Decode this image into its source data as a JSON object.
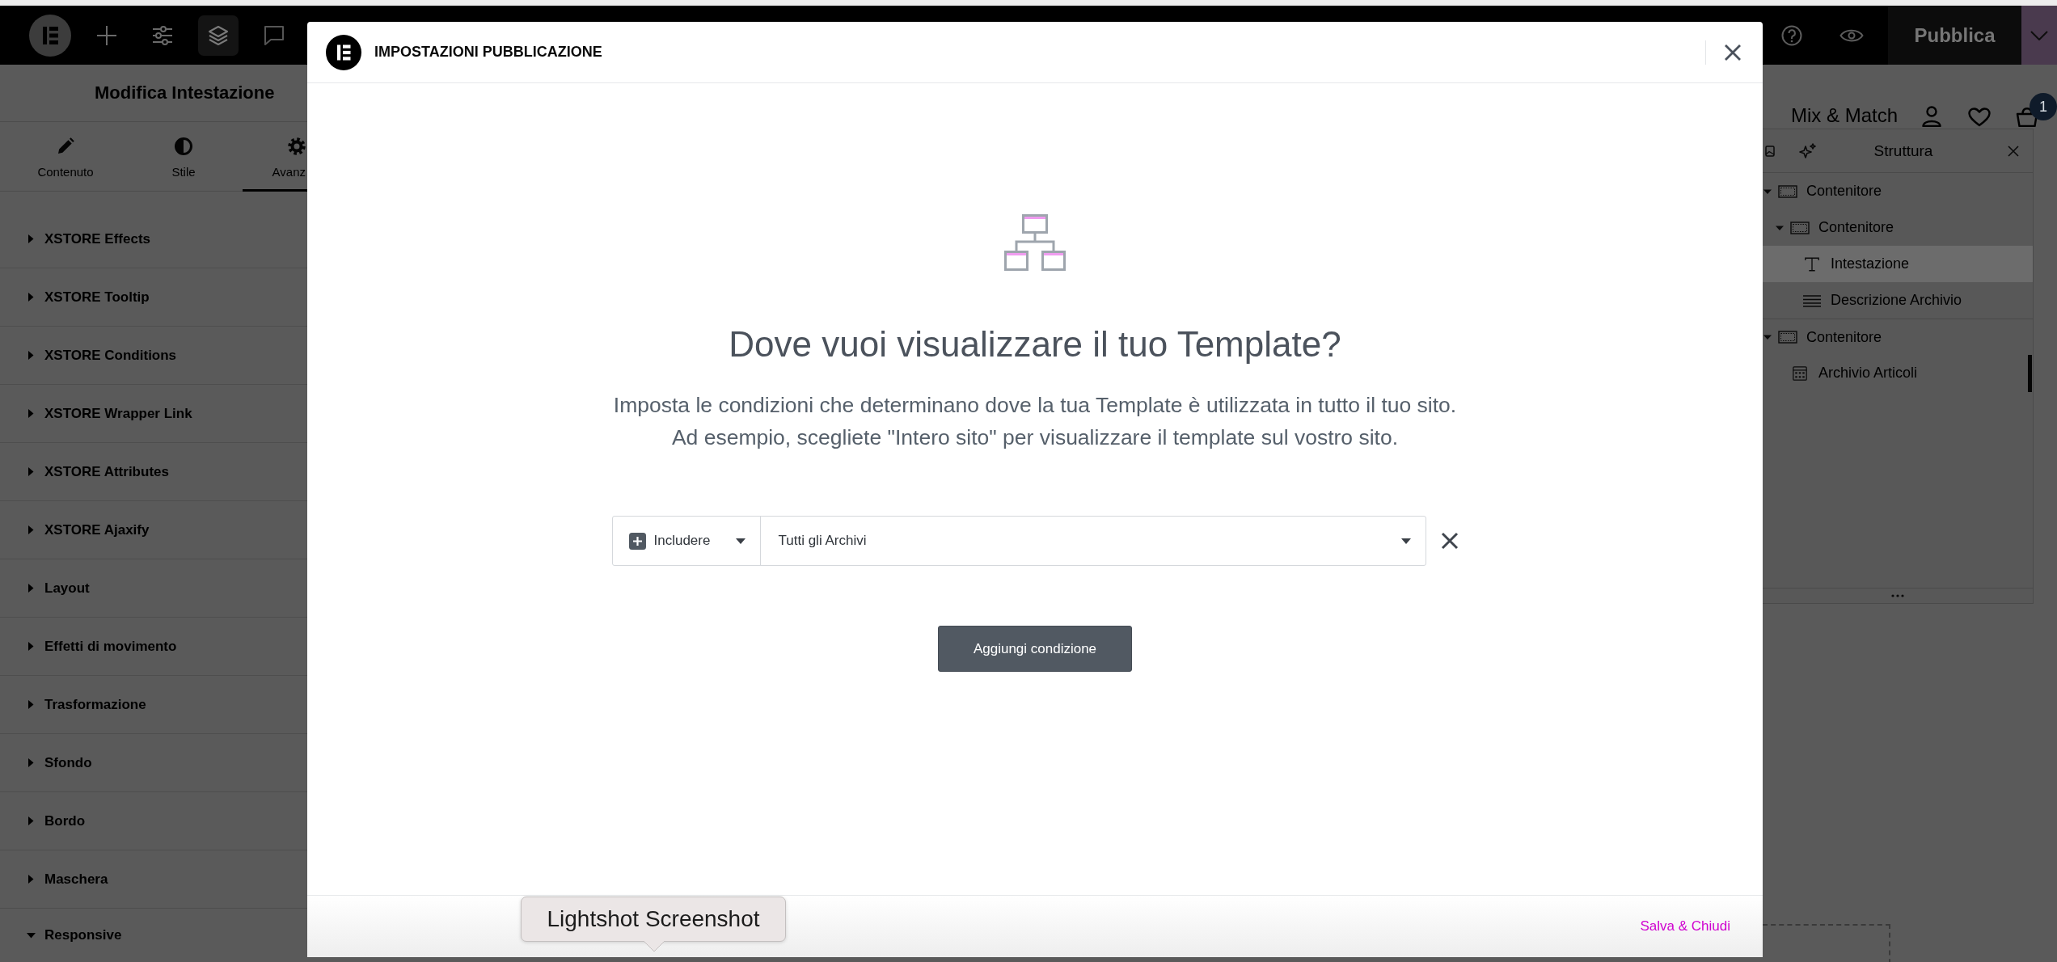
{
  "toolbar": {
    "publish_button": "Pubblica"
  },
  "editor_panel": {
    "title": "Modifica Intestazione",
    "tabs": [
      {
        "label": "Contenuto",
        "kind": "pencil",
        "selected": false
      },
      {
        "label": "Stile",
        "kind": "contrast",
        "selected": false
      },
      {
        "label": "Avanz",
        "kind": "gear",
        "selected": true
      }
    ],
    "sections": [
      {
        "label": "XSTORE Effects",
        "expanded": false
      },
      {
        "label": "XSTORE Tooltip",
        "expanded": false
      },
      {
        "label": "XSTORE Conditions",
        "expanded": false
      },
      {
        "label": "XSTORE Wrapper Link",
        "expanded": false
      },
      {
        "label": "XSTORE Attributes",
        "expanded": false
      },
      {
        "label": "XSTORE Ajaxify",
        "expanded": false
      },
      {
        "label": "Layout",
        "expanded": false
      },
      {
        "label": "Effetti di movimento",
        "expanded": false
      },
      {
        "label": "Trasformazione",
        "expanded": false
      },
      {
        "label": "Sfondo",
        "expanded": false
      },
      {
        "label": "Bordo",
        "expanded": false
      },
      {
        "label": "Maschera",
        "expanded": false
      },
      {
        "label": "Responsive",
        "expanded": true
      }
    ]
  },
  "site_header": {
    "logo": "Mix & Match",
    "cart_count": "1"
  },
  "structure_panel": {
    "title": "Struttura",
    "items": [
      {
        "label": "Contenitore",
        "kind": "container",
        "expanded": true,
        "selected": false,
        "children": [
          {
            "label": "Contenitore",
            "kind": "container",
            "expanded": true,
            "selected": false,
            "children": [
              {
                "label": "Intestazione",
                "kind": "heading",
                "selected": true
              },
              {
                "label": "Descrizione Archivio",
                "kind": "text",
                "selected": false
              }
            ]
          }
        ]
      },
      {
        "label": "Contenitore",
        "kind": "container",
        "expanded": true,
        "selected": false,
        "children": [
          {
            "label": "Archivio Articoli",
            "kind": "grid",
            "selected": false
          }
        ]
      }
    ]
  },
  "modal": {
    "title": "IMPOSTAZIONI PUBBLICAZIONE",
    "heading": "Dove vuoi visualizzare il tuo Template?",
    "description": [
      "Imposta le condizioni che determinano dove la tua Template è utilizzata in tutto il tuo sito.",
      "Ad esempio, scegliete \"Intero sito\" per visualizzare il template sul vostro sito."
    ],
    "conditions": [
      {
        "type": "Includere",
        "value": "Tutti gli Archivi"
      }
    ],
    "add_button": "Aggiungi condizione",
    "save_link": "Salva & Chiudi"
  },
  "tooltip": {
    "text": "Lightshot Screenshot"
  }
}
